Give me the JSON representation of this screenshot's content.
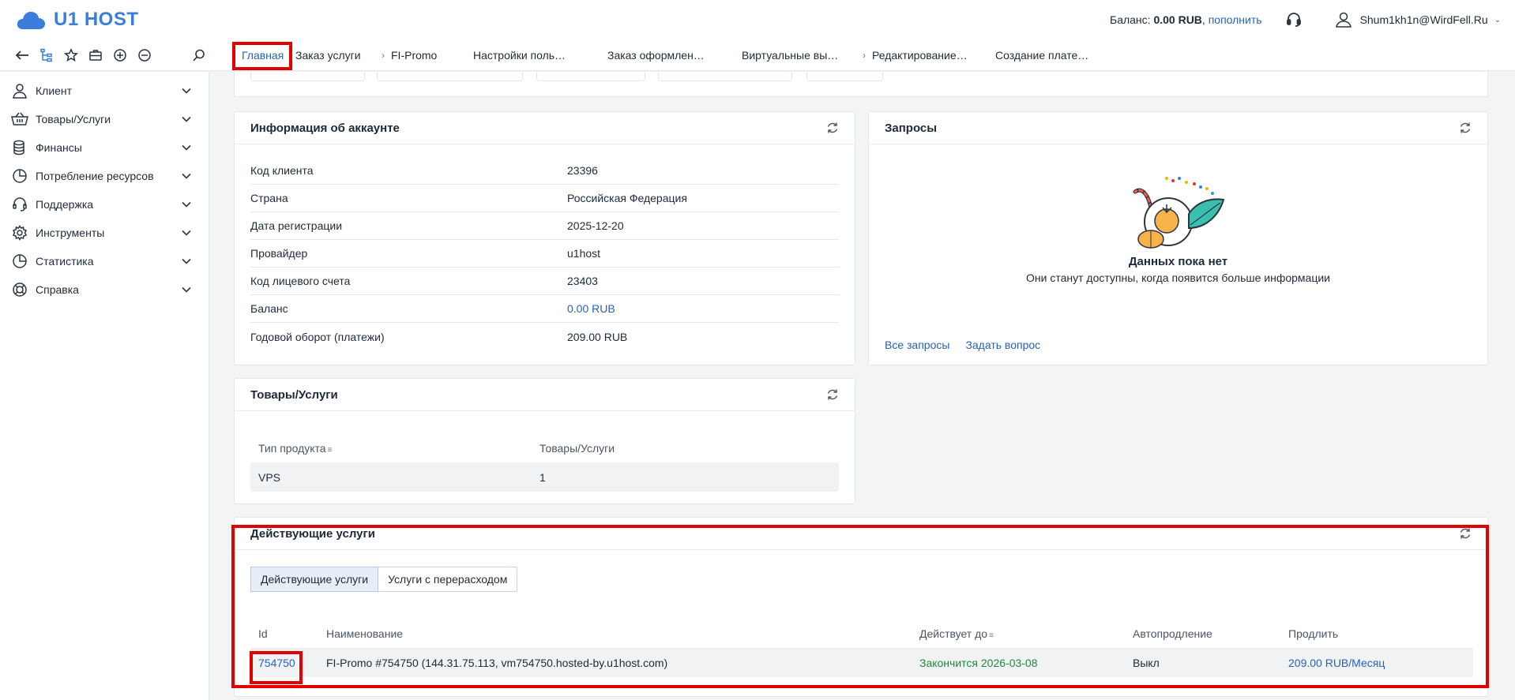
{
  "header": {
    "logo_text": "U1 HOST",
    "balance_label": "Баланс:",
    "balance_value": "0.00 RUB",
    "balance_separator": ",",
    "topup_link": "пополнить",
    "user_name": "Shum1kh1n@WirdFell.Ru"
  },
  "tabs": [
    {
      "label": "Главная"
    },
    {
      "label": "Заказ услуги"
    },
    {
      "label": "FI-Promo"
    },
    {
      "label": "Настройки поль…"
    },
    {
      "label": "Заказ оформлен…"
    },
    {
      "label": "Виртуальные вы…"
    },
    {
      "label": "Редактирование…"
    },
    {
      "label": "Создание плате…"
    }
  ],
  "sidebar": {
    "items": [
      {
        "label": "Клиент",
        "icon": "user-icon"
      },
      {
        "label": "Товары/Услуги",
        "icon": "basket-icon"
      },
      {
        "label": "Финансы",
        "icon": "coins-icon"
      },
      {
        "label": "Потребление ресурсов",
        "icon": "pie-chart-icon"
      },
      {
        "label": "Поддержка",
        "icon": "headset-icon"
      },
      {
        "label": "Инструменты",
        "icon": "gear-icon"
      },
      {
        "label": "Статистика",
        "icon": "pie-chart-icon"
      },
      {
        "label": "Справка",
        "icon": "lifebuoy-icon"
      }
    ]
  },
  "account_panel": {
    "title": "Информация об аккаунте",
    "rows": [
      {
        "label": "Код клиента",
        "value": "23396"
      },
      {
        "label": "Страна",
        "value": "Российская Федерация"
      },
      {
        "label": "Дата регистрации",
        "value": "2025-12-20"
      },
      {
        "label": "Провайдер",
        "value": "u1host"
      },
      {
        "label": "Код лицевого счета",
        "value": "23403"
      },
      {
        "label": "Баланс",
        "value": "0.00 RUB"
      },
      {
        "label": "Годовой оборот (платежи)",
        "value": "209.00 RUB"
      }
    ]
  },
  "requests_panel": {
    "title": "Запросы",
    "empty_title": "Данных пока нет",
    "empty_subtitle": "Они станут доступны, когда появится больше информации",
    "all_requests_link": "Все запросы",
    "ask_question_link": "Задать вопрос"
  },
  "products_panel": {
    "title": "Товары/Услуги",
    "columns": [
      "Тип продукта",
      "Товары/Услуги"
    ],
    "rows": [
      {
        "type": "VPS",
        "count": "1"
      }
    ]
  },
  "services_panel": {
    "title": "Действующие услуги",
    "sub_tabs": [
      {
        "label": "Действующие услуги"
      },
      {
        "label": "Услуги с перерасходом"
      }
    ],
    "columns": [
      "Id",
      "Наименование",
      "Действует до",
      "Автопродление",
      "Продлить"
    ],
    "rows": [
      {
        "id": "754750",
        "name": "FI-Promo #754750 (144.31.75.113, vm754750.hosted-by.u1host.com)",
        "until": "Закончится 2026-03-08",
        "autorenew": "Выкл",
        "price": "209.00 RUB",
        "period": "Месяц"
      }
    ]
  },
  "colors": {
    "accent": "#2563b8",
    "logo": "#3b7ddd",
    "highlight": "#e20000",
    "expires": "#1f8a3a"
  }
}
